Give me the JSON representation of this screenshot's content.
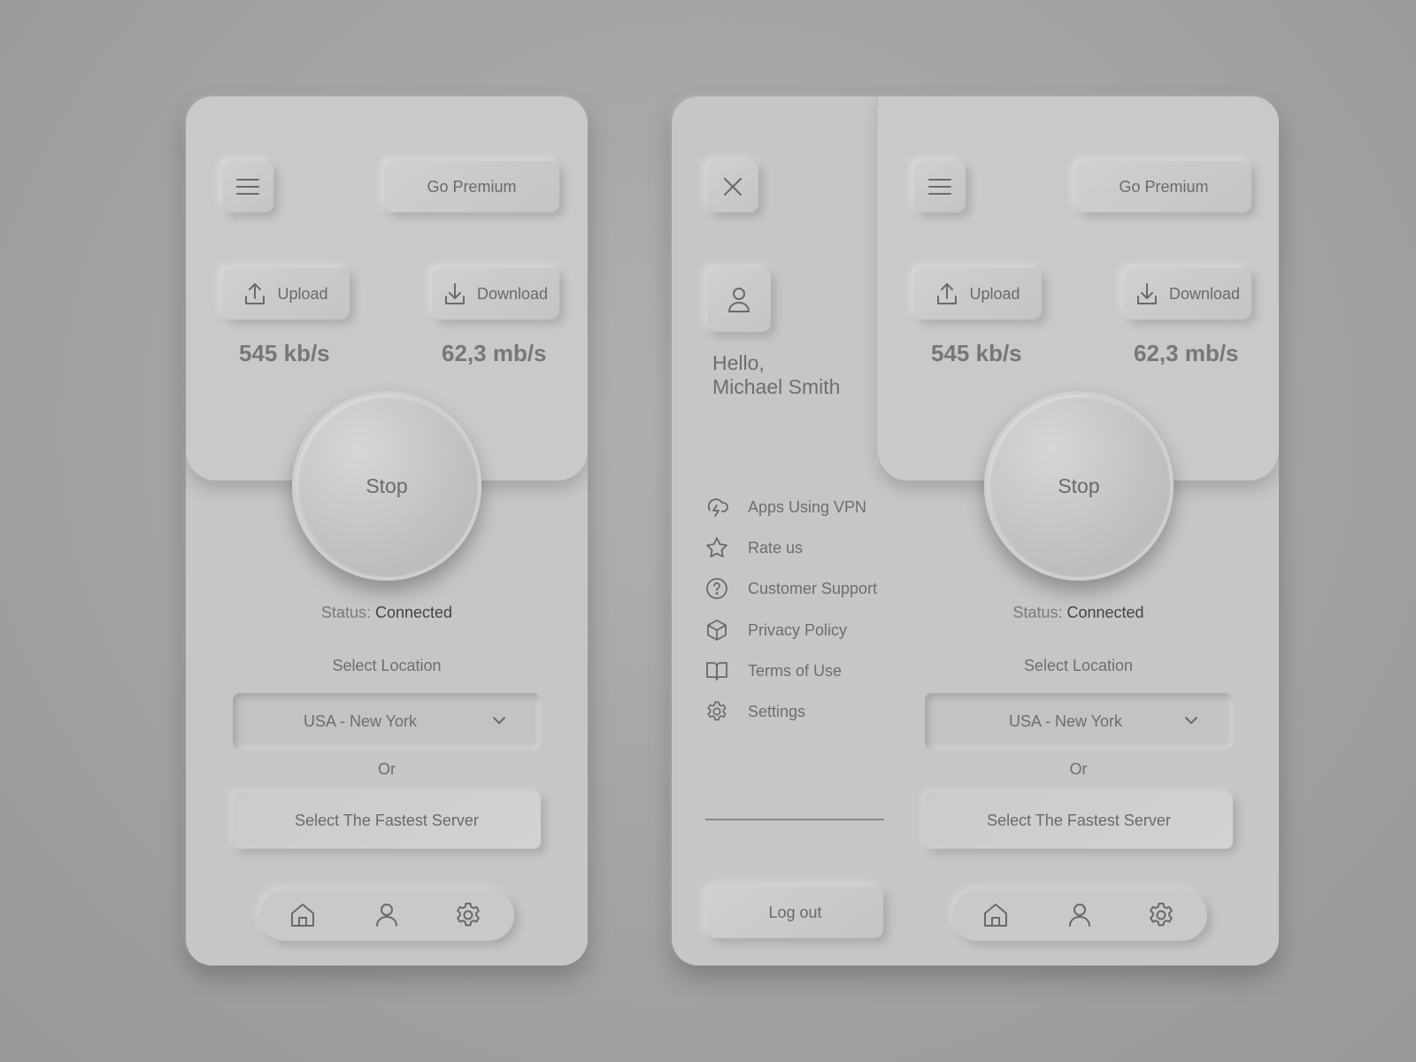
{
  "main_screen": {
    "go_premium": "Go Premium",
    "upload_label": "Upload",
    "download_label": "Download",
    "upload_speed": "545 kb/s",
    "download_speed": "62,3 mb/s",
    "stop_label": "Stop",
    "status_prefix": "Status:",
    "status_value": "Connected",
    "select_location_label": "Select Location",
    "location_value": "USA - New York",
    "or_label": "Or",
    "fastest_server_label": "Select The Fastest Server",
    "bottom_nav": [
      "home-icon",
      "user-icon",
      "gear-icon"
    ]
  },
  "drawer": {
    "greeting_line1": "Hello,",
    "greeting_line2": "Michael Smith",
    "menu_items": [
      {
        "label": "Apps Using VPN",
        "icon": "cloud-lightning-icon"
      },
      {
        "label": "Rate us",
        "icon": "star-icon"
      },
      {
        "label": "Customer Support",
        "icon": "help-circle-icon"
      },
      {
        "label": "Privacy Policy",
        "icon": "box-icon"
      },
      {
        "label": "Terms of Use",
        "icon": "book-icon"
      },
      {
        "label": "Settings",
        "icon": "gear-icon"
      }
    ],
    "logout_label": "Log out"
  }
}
